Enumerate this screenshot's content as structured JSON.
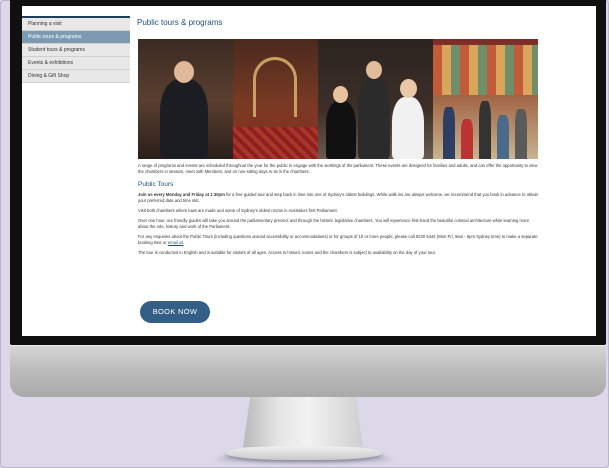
{
  "sidebar": {
    "items": [
      {
        "label": "Planning a visit"
      },
      {
        "label": "Public tours & programs"
      },
      {
        "label": "Student tours & programs"
      },
      {
        "label": "Events & exhibitions"
      },
      {
        "label": "Dining & Gift Shop"
      }
    ]
  },
  "main": {
    "title": "Public tours & programs",
    "intro": "A range of programs and events are scheduled throughout the year for the public to engage with the workings of the parliament. These events are designed for families and adults, and can offer the opportunity to view the chambers in session, meet with Members, and on non-sitting days to sit in the chambers.",
    "section_title": "Public Tours",
    "tour_bold": "Join us every Monday and Friday at 1:30pm",
    "tour_rest": " for a free guided tour and step back in time into one of Sydney's oldest buildings. While walk ins are always welcome, we recommend that you book in advance to obtain your preferred date and time slot.",
    "visit_text": "Visit both chambers where laws are made and some of Sydney's oldest rooms in Australia's first Parliament.",
    "hour_text": "Over one hour, our friendly guides will take you around the parliamentary precinct and through the historic legislative chambers. You will experience first-hand the beautiful colonial architecture while learning more about the role, history and work of the Parliament.",
    "enquiry_text": "For any enquiries about the Public Tours (including questions around accessibility or accommodations) or for groups of 10 or more people, please call 9230 5444 (Mon-Fri, 9am - 5pm Sydney time) to make a separate booking time or",
    "email_link": "email us",
    "english_text": "The tour is conducted in English and is suitable for visitors of all ages. Access to historic rooms and the chambers is subject to availability on the day of your tour.",
    "book_label": "BOOK NOW"
  },
  "colors": {
    "accent": "#1f4e79",
    "button": "#335f87",
    "sidebar_active": "#7c9bb3"
  }
}
